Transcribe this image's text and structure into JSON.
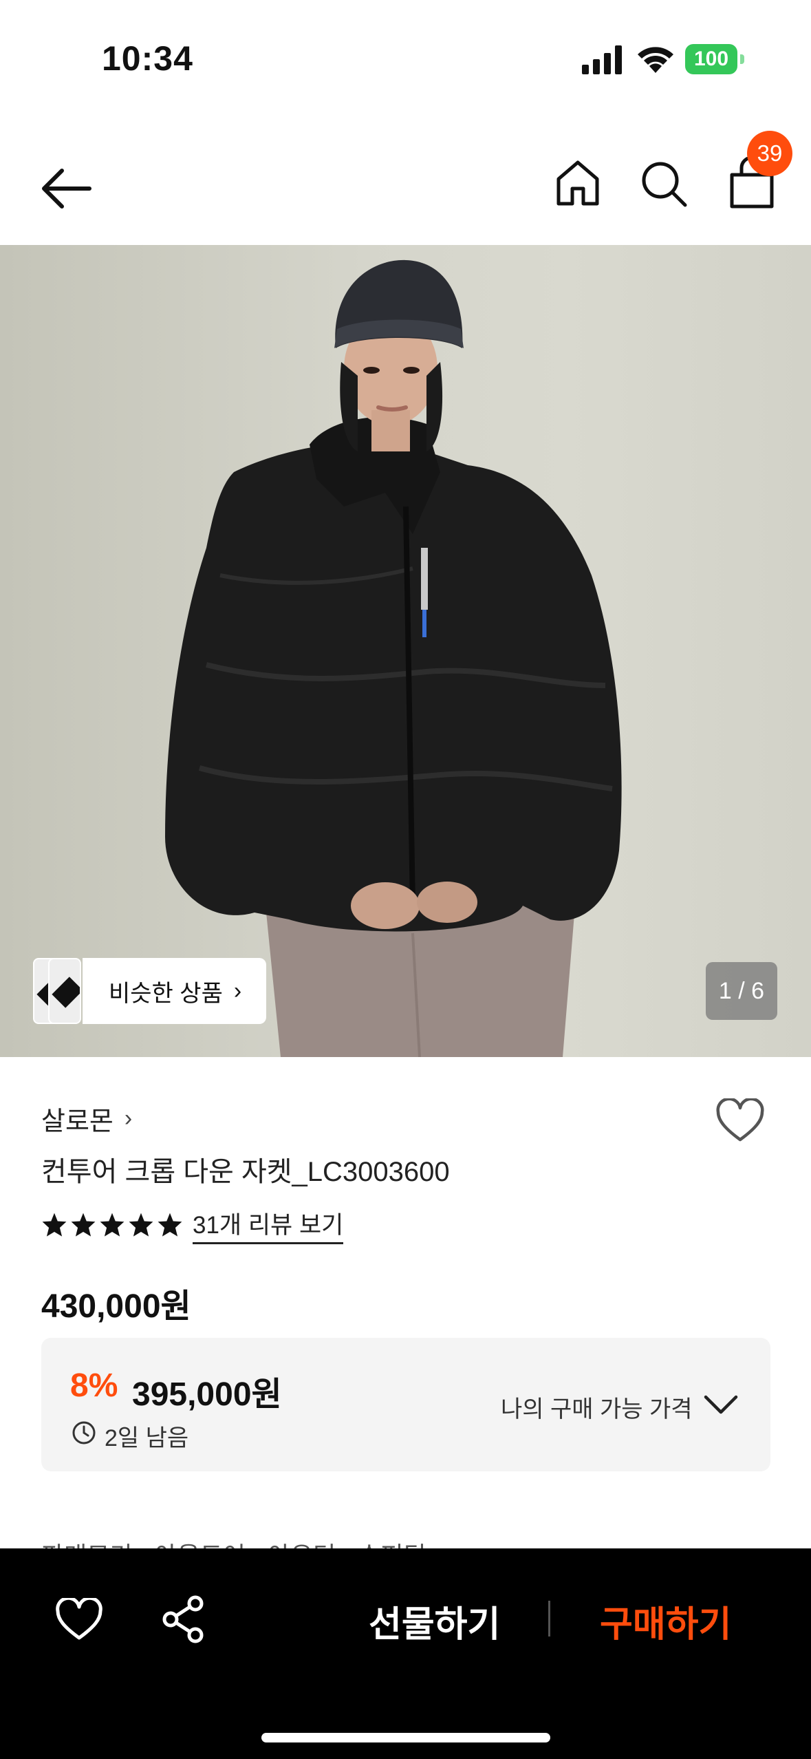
{
  "status_bar": {
    "time": "10:34",
    "battery": "100"
  },
  "nav": {
    "cart_count": "39"
  },
  "hero": {
    "similar_label": "비슷한 상품",
    "counter": "1 / 6"
  },
  "product": {
    "brand": "살로몬",
    "name": "컨투어 크롭 다운 자켓_LC3003600",
    "rating_stars": 5,
    "review_link": "31개 리뷰 보기",
    "original_price": "430,000원",
    "discount_percent": "8%",
    "sale_price": "395,000원",
    "time_left": "2일 남음",
    "my_price_label": "나의 구매 가능 가격"
  },
  "category_crumb": "판매모기   ·   아웃도어 · 아우터 · 슈퍼딤",
  "bottom_bar": {
    "gift_label": "선물하기",
    "buy_label": "구매하기"
  },
  "colors": {
    "accent": "#ff4d0d",
    "battery_green": "#34c759"
  },
  "icons": [
    "back-arrow-icon",
    "home-icon",
    "search-icon",
    "shopping-bag-icon",
    "heart-icon",
    "share-icon",
    "clock-icon",
    "chevron-down-icon",
    "star-icon"
  ]
}
